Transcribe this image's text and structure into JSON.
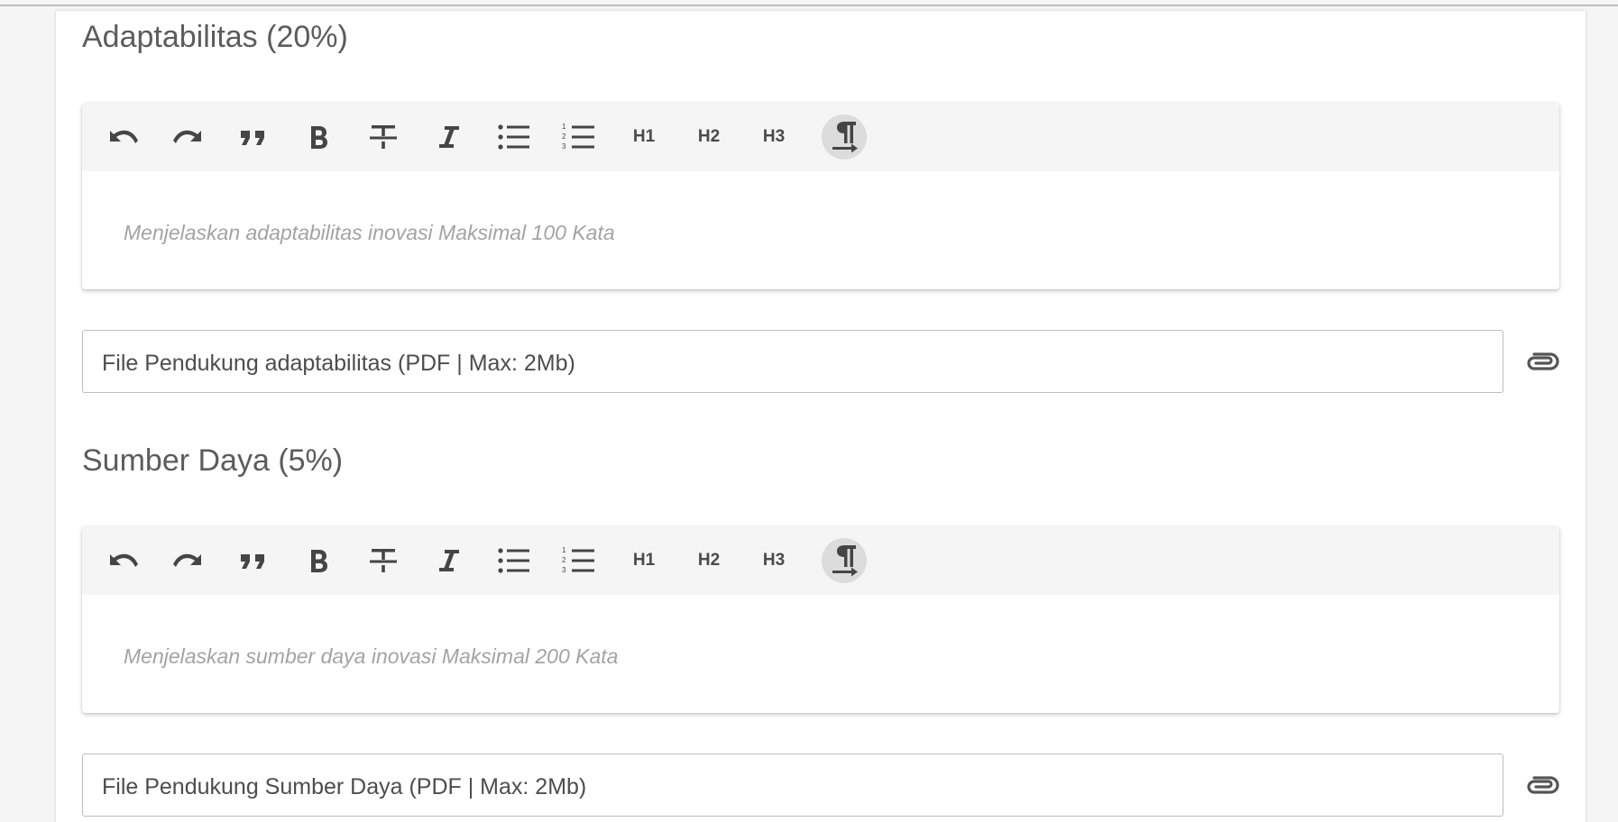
{
  "sections": [
    {
      "title": "Adaptabilitas (20%)",
      "editor_placeholder": "Menjelaskan adaptabilitas inovasi Maksimal 100 Kata",
      "file_label": "File Pendukung adaptabilitas (PDF | Max: 2Mb)"
    },
    {
      "title": "Sumber Daya (5%)",
      "editor_placeholder": "Menjelaskan sumber daya inovasi Maksimal 200 Kata",
      "file_label": "File Pendukung Sumber Daya (PDF | Max: 2Mb)"
    }
  ],
  "toolbar": {
    "icons": [
      "undo-icon",
      "redo-icon",
      "blockquote-icon",
      "bold-icon",
      "strikethrough-icon",
      "italic-icon",
      "bullet-list-icon",
      "ordered-list-icon",
      "h1",
      "h2",
      "h3",
      "paragraph-icon"
    ],
    "h1_label": "H1",
    "h2_label": "H2",
    "h3_label": "H3"
  },
  "attach_icon": "paperclip-icon",
  "colors": {
    "toolbar_bg": "#f5f5f5",
    "active_button_bg": "#dcdcdc",
    "placeholder_text": "#a3a3a3"
  }
}
